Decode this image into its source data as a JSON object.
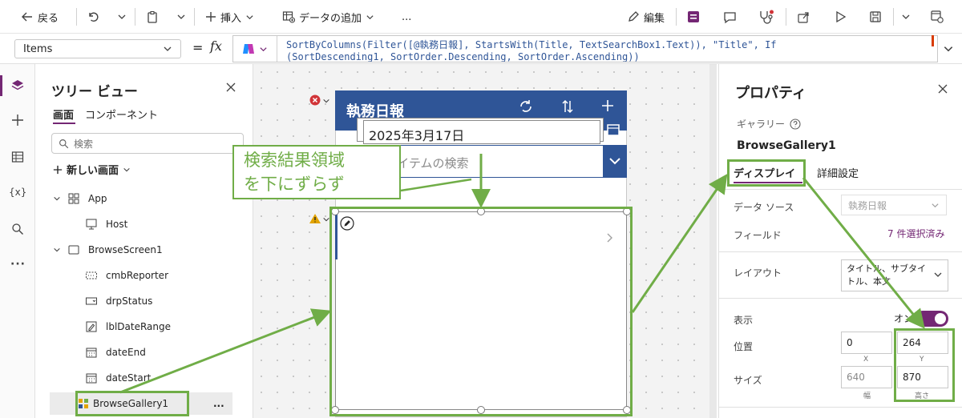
{
  "toolbar": {
    "back": "戻る",
    "insert": "挿入",
    "add_data": "データの追加",
    "more": "...",
    "edit": "編集"
  },
  "formula": {
    "property": "Items",
    "equals": "=",
    "fx": "fx",
    "line1": "SortByColumns(Filter([@執務日報], StartsWith(Title, TextSearchBox1.Text)), \"Title\", If",
    "line2": "(SortDescending1, SortOrder.Descending, SortOrder.Ascending))"
  },
  "tree": {
    "title": "ツリー ビュー",
    "tab_screens": "画面",
    "tab_components": "コンポーネント",
    "search_placeholder": "検索",
    "new_screen": "新しい画面",
    "items": [
      {
        "label": "App",
        "icon": "app-icon"
      },
      {
        "label": "Host",
        "icon": "host-icon"
      },
      {
        "label": "BrowseScreen1",
        "icon": "screen-icon"
      },
      {
        "label": "cmbReporter",
        "icon": "combobox-icon"
      },
      {
        "label": "drpStatus",
        "icon": "dropdown-icon"
      },
      {
        "label": "lblDateRange",
        "icon": "label-icon"
      },
      {
        "label": "dateEnd",
        "icon": "calendar-icon"
      },
      {
        "label": "dateStart",
        "icon": "calendar-icon"
      },
      {
        "label": "BrowseGallery1",
        "icon": "gallery-icon"
      }
    ],
    "item_more": "..."
  },
  "canvas": {
    "header_title": "執務日報",
    "date_value": "2025年3月17日",
    "search_placeholder": "アイテムの検索",
    "annotation": "検索結果領域\nを下にずらず"
  },
  "props": {
    "title": "プロパティ",
    "type": "ギャラリー",
    "name": "BrowseGallery1",
    "tab_display": "ディスプレイ",
    "tab_advanced": "詳細設定",
    "datasource_label": "データ ソース",
    "datasource_value": "執務日報",
    "fields_label": "フィールド",
    "fields_value": "7 件選択済み",
    "layout_label": "レイアウト",
    "layout_value": "タイトル、サブタイトル、本文",
    "visible_label": "表示",
    "visible_value": "オン",
    "position_label": "位置",
    "pos_x": "0",
    "pos_y": "264",
    "x_caption": "X",
    "y_caption": "Y",
    "size_label": "サイズ",
    "width": "640",
    "height": "870",
    "width_caption": "幅",
    "height_caption": "高さ"
  },
  "colors": {
    "accent": "#742774",
    "header_blue": "#2f5597",
    "annotation_green": "#70ad47",
    "error_red": "#d13438",
    "warning_yellow": "#e3a400"
  }
}
